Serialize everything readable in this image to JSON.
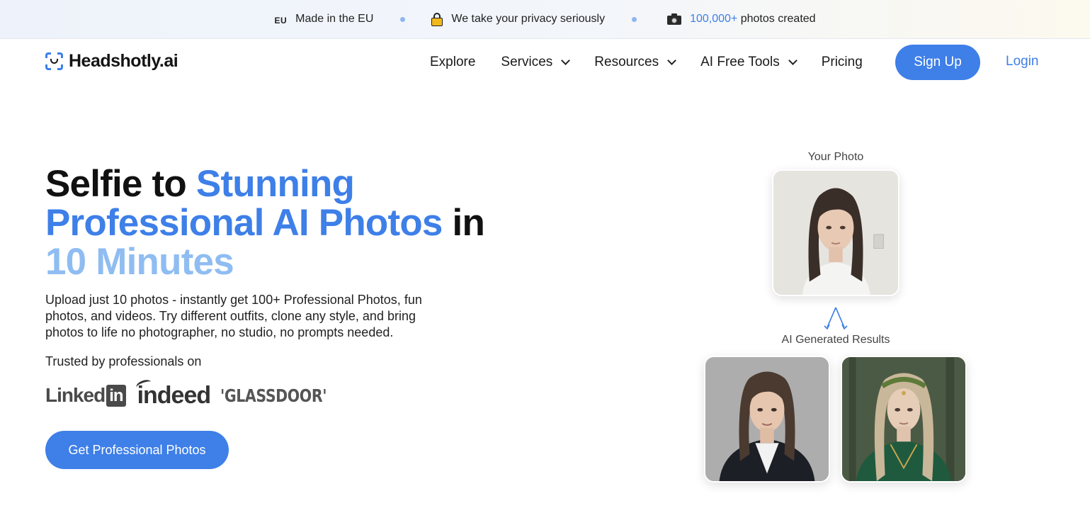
{
  "topbar": {
    "eu_badge": "EU",
    "made_in_eu": "Made in the EU",
    "privacy": "We take your privacy seriously",
    "photos_count": "100,000+",
    "photos_created": "photos created"
  },
  "brand": {
    "name": "Headshotly.ai",
    "accent": "#3e7fe8"
  },
  "nav": {
    "items": [
      {
        "label": "Explore",
        "dropdown": false
      },
      {
        "label": "Services",
        "dropdown": true
      },
      {
        "label": "Resources",
        "dropdown": true
      },
      {
        "label": "AI Free Tools",
        "dropdown": true
      },
      {
        "label": "Pricing",
        "dropdown": false
      }
    ],
    "signup": "Sign Up",
    "login": "Login"
  },
  "hero": {
    "title_part1": "Selfie to ",
    "title_part2": "Stunning Professional AI Photos",
    "title_part3": " in ",
    "title_part4": "10 Minutes",
    "description": "Upload just 10 photos - instantly get 100+ Professional Photos, fun photos, and videos. Try different outfits, clone any style, and bring photos to life no photographer, no studio, no prompts needed.",
    "trusted": "Trusted by professionals on",
    "logos": {
      "linkedin_a": "Linked",
      "linkedin_b": "in",
      "indeed": "indeed",
      "glassdoor": "'GLASSDOOR'"
    },
    "cta": "Get Professional Photos"
  },
  "showcase": {
    "your_photo": "Your Photo",
    "ai_results": "AI Generated Results"
  }
}
